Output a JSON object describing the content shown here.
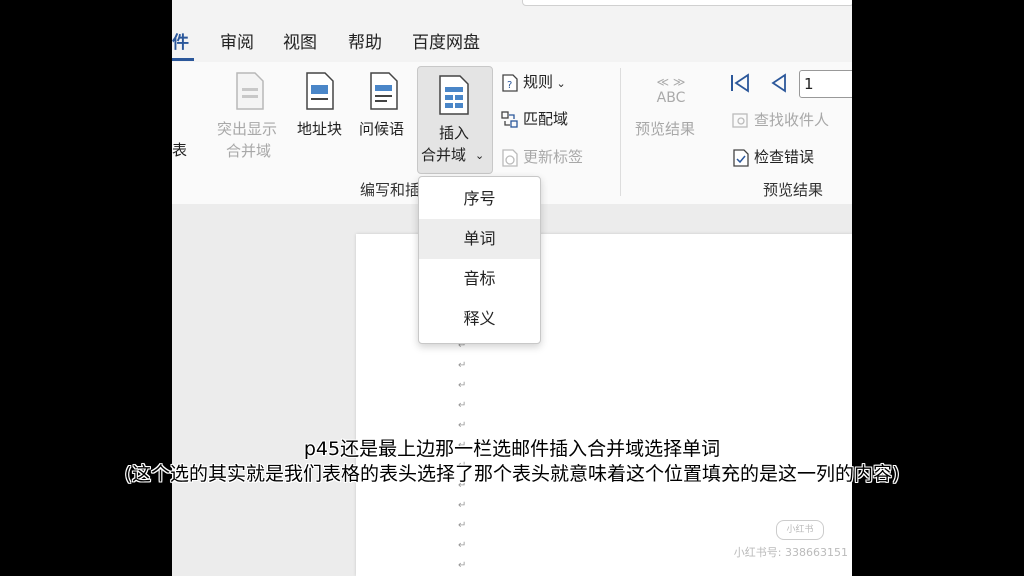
{
  "menu": {
    "items": [
      "件",
      "审阅",
      "视图",
      "帮助",
      "百度网盘"
    ]
  },
  "ribbon": {
    "highlight_merge": "突出显示",
    "highlight_merge2": "合并域",
    "address_block": "地址块",
    "greeting": "问候语",
    "insert_merge_1": "插入",
    "insert_merge_2": "合并域",
    "rules": "规则",
    "match_fields": "匹配域",
    "update_labels": "更新标签",
    "preview_results": "预览结果",
    "abc": "ABC",
    "find_recipient": "查找收件人",
    "check_errors": "检查错误",
    "record_value": "1",
    "left_cut_label": "表",
    "group_write_insert": "编写和插",
    "group_preview": "预览结果"
  },
  "dropdown": {
    "items": [
      "序号",
      "单词",
      "音标",
      "释义"
    ]
  },
  "subtitle": {
    "line1": "p45还是最上边那一栏选邮件插入合并域选择单词",
    "line2": "(这个选的其实就是我们表格的表头选择了那个表头就意味着这个位置填充的是这一列的内容)"
  },
  "watermark": {
    "logo": "小红书",
    "id": "小红书号: 338663151"
  },
  "colors": {
    "accent": "#2b579a",
    "background": "#000000"
  }
}
